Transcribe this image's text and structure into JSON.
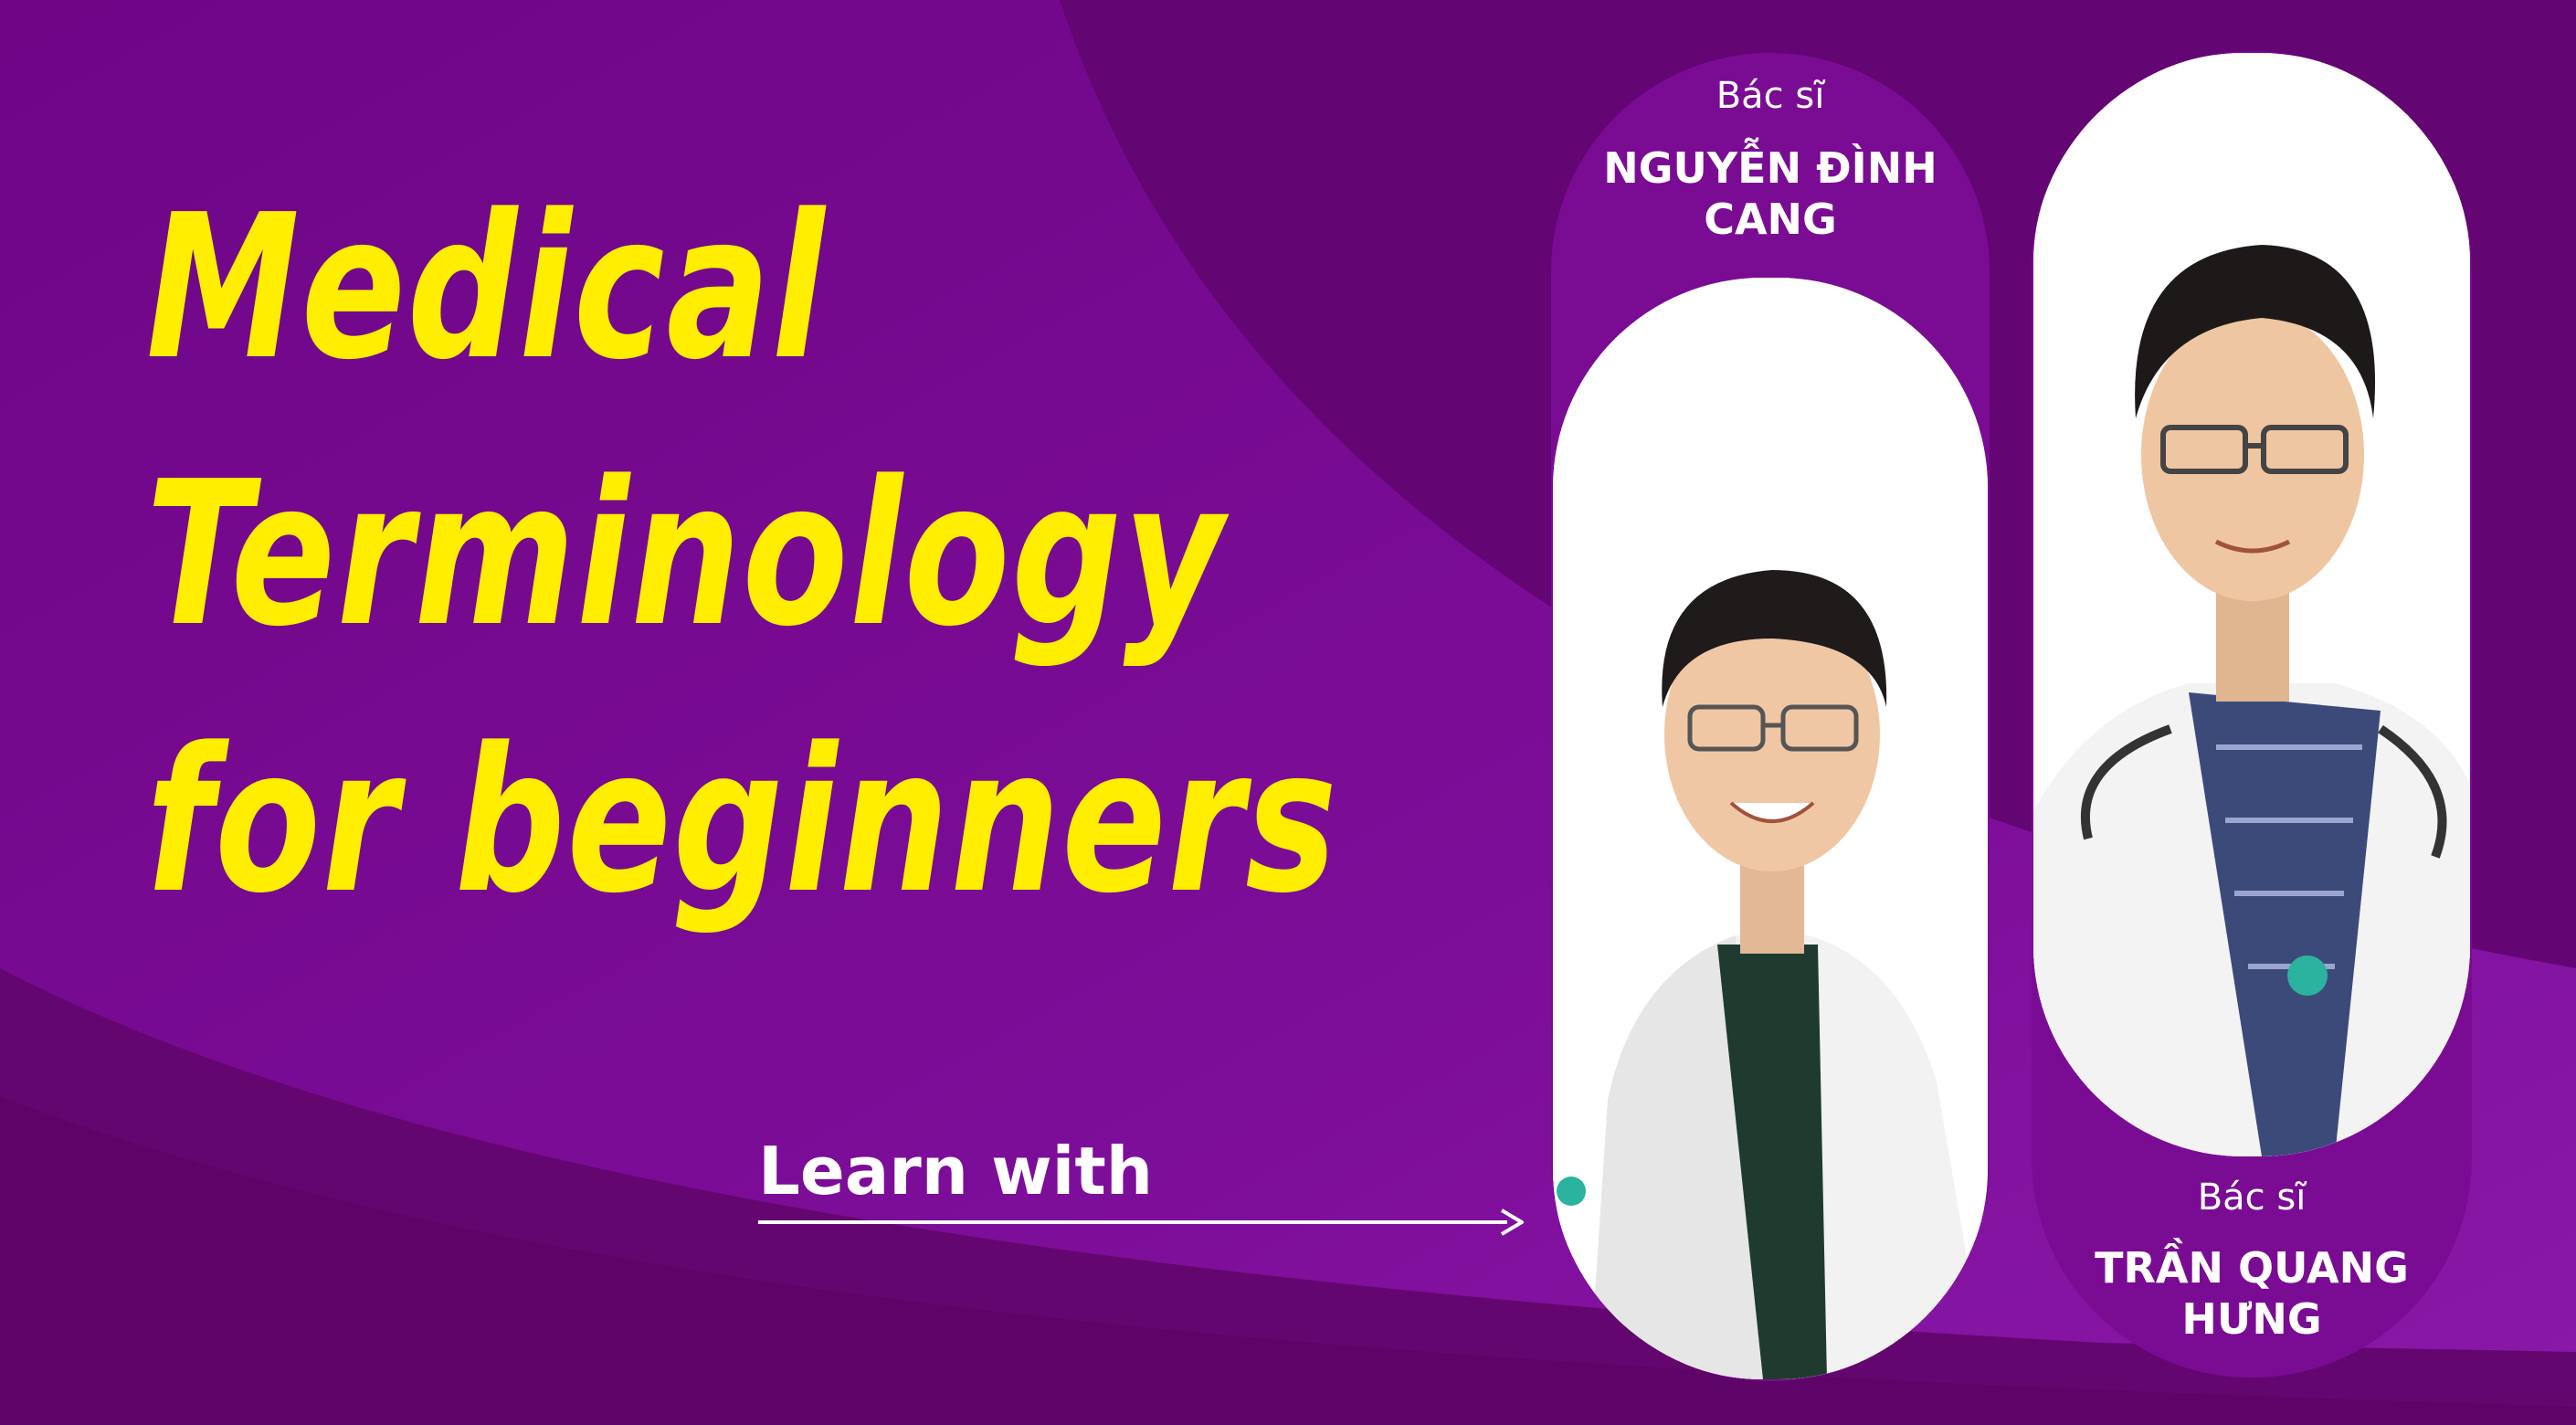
{
  "title": {
    "line1": "Medical",
    "line2": "Terminology",
    "line3": "for beginners"
  },
  "learn_with": "Learn with",
  "doctors": [
    {
      "prefix": "Bác sĩ",
      "name_line1": "NGUYỄN ĐÌNH",
      "name_line2": "CANG"
    },
    {
      "prefix": "Bác sĩ",
      "name_line1": "TRẦN QUANG",
      "name_line2": "HƯNG"
    }
  ],
  "colors": {
    "background": "#6a0680",
    "accent_yellow": "#ffee00",
    "pill_purple": "#7a0c94"
  }
}
